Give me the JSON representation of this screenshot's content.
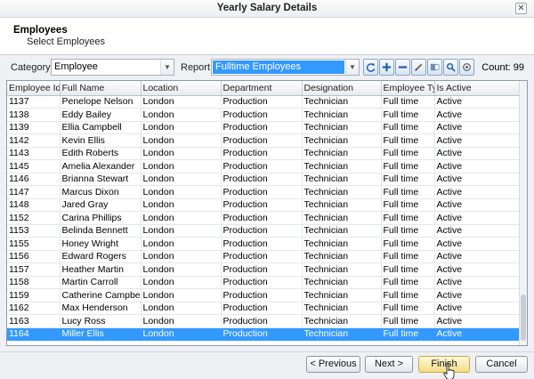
{
  "window": {
    "title": "Yearly Salary Details",
    "close_glyph": "✕"
  },
  "header": {
    "title": "Employees",
    "subtitle": "Select Employees"
  },
  "toolbar": {
    "category_label": "Category",
    "category_value": "Employee",
    "report_label": "Report",
    "report_value": "Fulltime Employees",
    "count_text": "Count: 99",
    "icons": [
      "refresh-icon",
      "add-icon",
      "remove-icon",
      "edit-icon",
      "export-icon",
      "search-icon",
      "print-icon"
    ]
  },
  "table": {
    "columns": [
      "Employee Id",
      "Full Name",
      "Location",
      "Department",
      "Designation",
      "Employee Type",
      "Is Active"
    ],
    "rows": [
      [
        "1137",
        "Penelope Nelson",
        "London",
        "Production",
        "Technician",
        "Full time",
        "Active"
      ],
      [
        "1138",
        "Eddy Bailey",
        "London",
        "Production",
        "Technician",
        "Full time",
        "Active"
      ],
      [
        "1139",
        "Ellia Campbell",
        "London",
        "Production",
        "Technician",
        "Full time",
        "Active"
      ],
      [
        "1142",
        "Kevin Ellis",
        "London",
        "Production",
        "Technician",
        "Full time",
        "Active"
      ],
      [
        "1143",
        "Edith Roberts",
        "London",
        "Production",
        "Technician",
        "Full time",
        "Active"
      ],
      [
        "1145",
        "Amelia Alexander",
        "London",
        "Production",
        "Technician",
        "Full time",
        "Active"
      ],
      [
        "1146",
        "Brianna Stewart",
        "London",
        "Production",
        "Technician",
        "Full time",
        "Active"
      ],
      [
        "1147",
        "Marcus Dixon",
        "London",
        "Production",
        "Technician",
        "Full time",
        "Active"
      ],
      [
        "1148",
        "Jared Gray",
        "London",
        "Production",
        "Technician",
        "Full time",
        "Active"
      ],
      [
        "1152",
        "Carina Phillips",
        "London",
        "Production",
        "Technician",
        "Full time",
        "Active"
      ],
      [
        "1153",
        "Belinda Bennett",
        "London",
        "Production",
        "Technician",
        "Full time",
        "Active"
      ],
      [
        "1155",
        "Honey Wright",
        "London",
        "Production",
        "Technician",
        "Full time",
        "Active"
      ],
      [
        "1156",
        "Edward Rogers",
        "London",
        "Production",
        "Technician",
        "Full time",
        "Active"
      ],
      [
        "1157",
        "Heather Martin",
        "London",
        "Production",
        "Technician",
        "Full time",
        "Active"
      ],
      [
        "1158",
        "Martin Carroll",
        "London",
        "Production",
        "Technician",
        "Full time",
        "Active"
      ],
      [
        "1159",
        "Catherine Campbell",
        "London",
        "Production",
        "Technician",
        "Full time",
        "Active"
      ],
      [
        "1162",
        "Max Henderson",
        "London",
        "Production",
        "Technician",
        "Full time",
        "Active"
      ],
      [
        "1163",
        "Lucy Ross",
        "London",
        "Production",
        "Technician",
        "Full time",
        "Active"
      ],
      [
        "1164",
        "Miller Ellis",
        "London",
        "Production",
        "Technician",
        "Full time",
        "Active"
      ]
    ],
    "selected_row_index": 18
  },
  "buttons": {
    "previous": "< Previous",
    "next": "Next >",
    "finish": "Finish",
    "cancel": "Cancel"
  },
  "colors": {
    "selection": "#3399ff",
    "header_bg": "#ffffff",
    "panel_bg": "#eef0f3"
  }
}
